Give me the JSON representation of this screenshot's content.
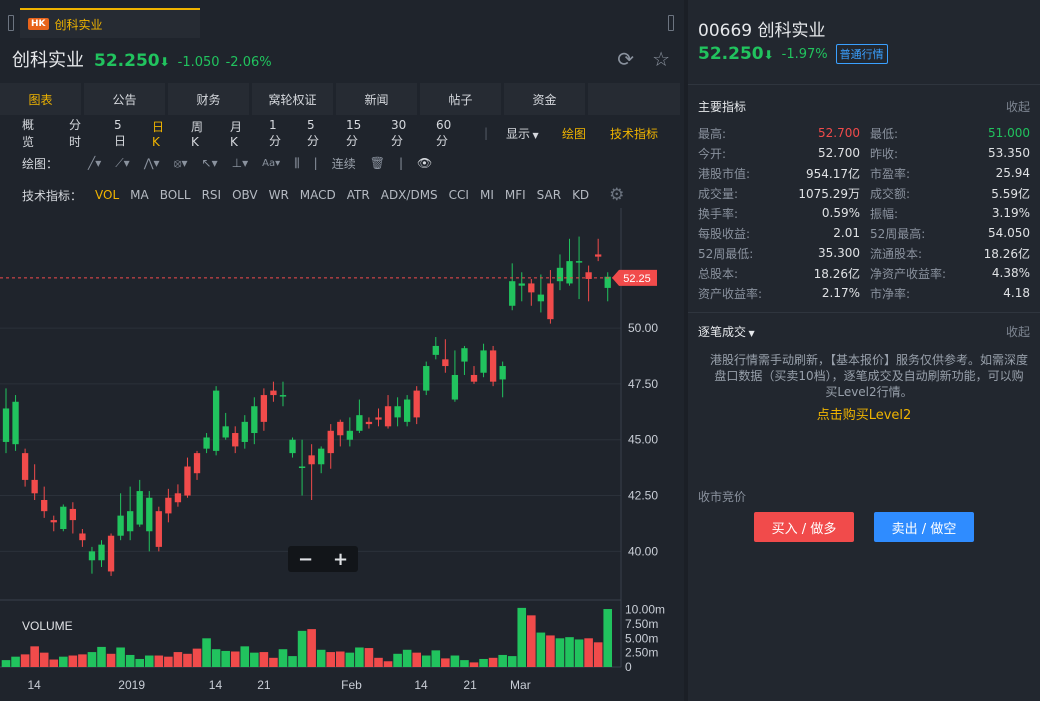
{
  "window_tab": {
    "badge": "HK",
    "label": "创科实业"
  },
  "header": {
    "name": "创科实业",
    "price": "52.250",
    "arrow": "⬇",
    "change": "-1.050",
    "change_pct": "-2.06%"
  },
  "main_tabs": [
    "图表",
    "公告",
    "财务",
    "窝轮权证",
    "新闻",
    "帖子",
    "资金"
  ],
  "periods": [
    "概览",
    "分时",
    "5日",
    "日K",
    "周K",
    "月K",
    "1分",
    "5分",
    "15分",
    "30分",
    "60分"
  ],
  "display_label": "显示",
  "drawing_label": "绘图",
  "tech_label": "技术指标",
  "drawbar": {
    "label": "绘图：",
    "continuous": "连续"
  },
  "indbar": {
    "label": "技术指标：",
    "items": [
      "VOL",
      "MA",
      "BOLL",
      "RSI",
      "OBV",
      "WR",
      "MACD",
      "ATR",
      "ADX/DMS",
      "CCI",
      "MI",
      "MFI",
      "SAR",
      "KD"
    ]
  },
  "chart_data": {
    "type": "candlestick",
    "price_axis": {
      "ticks": [
        "50.00",
        "47.50",
        "45.00",
        "42.50",
        "40.00"
      ],
      "ylim": [
        38.0,
        55.2
      ]
    },
    "current_price_label": "52.25",
    "current_price": 52.25,
    "x_labels": [
      "14",
      "2019",
      "14",
      "21",
      "Feb",
      "14",
      "21",
      "Mar"
    ],
    "volume_label": "VOLUME",
    "volume_axis": {
      "ticks": [
        "10.00m",
        "7.50m",
        "5.00m",
        "2.50m",
        "0"
      ],
      "ymax": 11.5
    },
    "candles": [
      {
        "o": 44.9,
        "c": 46.4,
        "h": 47.3,
        "l": 44.4
      },
      {
        "o": 44.8,
        "c": 46.7,
        "h": 47.0,
        "l": 44.5
      },
      {
        "o": 44.4,
        "c": 43.2,
        "h": 44.6,
        "l": 42.9
      },
      {
        "o": 43.2,
        "c": 42.6,
        "h": 43.9,
        "l": 42.3
      },
      {
        "o": 42.3,
        "c": 41.8,
        "h": 42.9,
        "l": 41.5
      },
      {
        "o": 41.4,
        "c": 41.3,
        "h": 41.6,
        "l": 40.9
      },
      {
        "o": 41.0,
        "c": 42.0,
        "h": 42.1,
        "l": 40.9
      },
      {
        "o": 41.9,
        "c": 41.4,
        "h": 42.2,
        "l": 40.8
      },
      {
        "o": 40.8,
        "c": 40.5,
        "h": 41.0,
        "l": 40.2
      },
      {
        "o": 39.6,
        "c": 40.0,
        "h": 40.2,
        "l": 39.0
      },
      {
        "o": 39.6,
        "c": 40.3,
        "h": 40.5,
        "l": 39.3
      },
      {
        "o": 40.7,
        "c": 39.1,
        "h": 40.8,
        "l": 38.9
      },
      {
        "o": 40.7,
        "c": 41.6,
        "h": 42.6,
        "l": 40.5
      },
      {
        "o": 40.9,
        "c": 41.8,
        "h": 42.9,
        "l": 40.5
      },
      {
        "o": 41.2,
        "c": 42.7,
        "h": 43.2,
        "l": 41.1
      },
      {
        "o": 40.9,
        "c": 42.4,
        "h": 42.7,
        "l": 40.0
      },
      {
        "o": 41.8,
        "c": 40.2,
        "h": 42.0,
        "l": 40.0
      },
      {
        "o": 42.4,
        "c": 41.7,
        "h": 42.8,
        "l": 41.3
      },
      {
        "o": 42.6,
        "c": 42.2,
        "h": 43.0,
        "l": 42.0
      },
      {
        "o": 43.8,
        "c": 42.5,
        "h": 44.2,
        "l": 42.4
      },
      {
        "o": 44.4,
        "c": 43.5,
        "h": 44.5,
        "l": 43.2
      },
      {
        "o": 44.6,
        "c": 45.1,
        "h": 45.3,
        "l": 44.4
      },
      {
        "o": 44.5,
        "c": 47.2,
        "h": 47.4,
        "l": 44.3
      },
      {
        "o": 45.1,
        "c": 45.6,
        "h": 46.2,
        "l": 45.0
      },
      {
        "o": 45.3,
        "c": 44.7,
        "h": 45.6,
        "l": 44.4
      },
      {
        "o": 44.9,
        "c": 45.8,
        "h": 46.1,
        "l": 44.6
      },
      {
        "o": 45.3,
        "c": 46.5,
        "h": 46.9,
        "l": 44.8
      },
      {
        "o": 47.0,
        "c": 45.8,
        "h": 47.3,
        "l": 45.4
      },
      {
        "o": 47.2,
        "c": 47.0,
        "h": 47.6,
        "l": 46.7
      },
      {
        "o": 47.0,
        "c": 47.0,
        "h": 47.6,
        "l": 46.5
      },
      {
        "o": 44.4,
        "c": 45.0,
        "h": 45.1,
        "l": 44.2
      },
      {
        "o": 43.8,
        "c": 43.8,
        "h": 45.0,
        "l": 42.5
      },
      {
        "o": 44.3,
        "c": 43.9,
        "h": 44.8,
        "l": 42.3
      },
      {
        "o": 43.9,
        "c": 44.6,
        "h": 44.7,
        "l": 43.5
      },
      {
        "o": 45.4,
        "c": 44.4,
        "h": 45.7,
        "l": 43.7
      },
      {
        "o": 45.8,
        "c": 45.2,
        "h": 45.9,
        "l": 44.7
      },
      {
        "o": 45.0,
        "c": 45.4,
        "h": 46.0,
        "l": 44.7
      },
      {
        "o": 45.4,
        "c": 46.1,
        "h": 46.8,
        "l": 45.3
      },
      {
        "o": 45.8,
        "c": 45.7,
        "h": 46.0,
        "l": 45.5
      },
      {
        "o": 46.0,
        "c": 45.9,
        "h": 46.4,
        "l": 45.6
      },
      {
        "o": 46.5,
        "c": 45.6,
        "h": 47.0,
        "l": 45.5
      },
      {
        "o": 46.0,
        "c": 46.5,
        "h": 46.9,
        "l": 45.6
      },
      {
        "o": 45.8,
        "c": 46.8,
        "h": 47.0,
        "l": 45.6
      },
      {
        "o": 47.2,
        "c": 46.0,
        "h": 47.4,
        "l": 45.7
      },
      {
        "o": 47.2,
        "c": 48.3,
        "h": 48.5,
        "l": 47.0
      },
      {
        "o": 48.8,
        "c": 49.2,
        "h": 49.6,
        "l": 48.6
      },
      {
        "o": 48.6,
        "c": 48.3,
        "h": 49.5,
        "l": 48.0
      },
      {
        "o": 46.8,
        "c": 47.9,
        "h": 49.0,
        "l": 46.7
      },
      {
        "o": 48.5,
        "c": 49.1,
        "h": 49.2,
        "l": 47.9
      },
      {
        "o": 47.9,
        "c": 47.6,
        "h": 48.3,
        "l": 47.5
      },
      {
        "o": 48.0,
        "c": 49.0,
        "h": 49.3,
        "l": 47.8
      },
      {
        "o": 49.0,
        "c": 47.6,
        "h": 49.2,
        "l": 47.4
      },
      {
        "o": 47.7,
        "c": 48.3,
        "h": 48.5,
        "l": 46.9
      },
      {
        "o": 51.0,
        "c": 52.1,
        "h": 52.9,
        "l": 50.8
      },
      {
        "o": 51.9,
        "c": 52.0,
        "h": 52.5,
        "l": 51.2
      },
      {
        "o": 52.0,
        "c": 51.6,
        "h": 52.2,
        "l": 51.0
      },
      {
        "o": 51.2,
        "c": 51.5,
        "h": 52.4,
        "l": 50.7
      },
      {
        "o": 52.0,
        "c": 50.4,
        "h": 52.6,
        "l": 50.2
      },
      {
        "o": 52.1,
        "c": 52.7,
        "h": 53.3,
        "l": 51.7
      },
      {
        "o": 52.0,
        "c": 53.0,
        "h": 54.0,
        "l": 51.9
      },
      {
        "o": 53.0,
        "c": 53.0,
        "h": 54.1,
        "l": 51.3
      },
      {
        "o": 52.5,
        "c": 52.2,
        "h": 52.8,
        "l": 51.2
      },
      {
        "o": 53.3,
        "c": 53.2,
        "h": 54.0,
        "l": 53.0
      },
      {
        "o": 51.8,
        "c": 52.3,
        "h": 52.5,
        "l": 51.2
      }
    ],
    "volume": [
      1.2,
      1.8,
      2.2,
      3.6,
      2.5,
      1.3,
      1.8,
      2.0,
      2.2,
      2.6,
      3.5,
      2.3,
      3.4,
      2.1,
      1.4,
      2.0,
      2.0,
      1.8,
      2.6,
      2.3,
      3.2,
      5.0,
      3.1,
      2.8,
      2.7,
      3.6,
      2.5,
      2.6,
      1.6,
      3.1,
      1.9,
      6.3,
      6.6,
      3.0,
      2.6,
      2.7,
      2.5,
      3.4,
      3.3,
      1.6,
      1.0,
      2.3,
      3.0,
      2.5,
      2.0,
      2.9,
      1.5,
      2.0,
      1.2,
      0.8,
      1.4,
      1.6,
      2.1,
      1.9,
      10.3,
      9.0,
      6.0,
      5.5,
      5.0,
      5.2,
      4.8,
      5.0,
      4.3,
      10.1
    ],
    "up_color": "#21c35e",
    "down_color": "#f14b4b"
  },
  "zoom": {
    "minus": "−",
    "plus": "+"
  },
  "right": {
    "title": "00669 创科实业",
    "price": "52.250",
    "arrow": "⬇",
    "change_pct": "-1.97%",
    "quote_badge": "普通行情",
    "metrics_title": "主要指标",
    "collapse": "收起",
    "metrics": [
      {
        "l1": "最高:",
        "v1": "52.700",
        "c1": "#f14b4b",
        "l2": "最低:",
        "v2": "51.000",
        "c2": "#21c35e"
      },
      {
        "l1": "今开:",
        "v1": "52.700",
        "c1": "",
        "l2": "昨收:",
        "v2": "53.350",
        "c2": ""
      },
      {
        "l1": "港股市值:",
        "v1": "954.17亿",
        "c1": "",
        "l2": "市盈率:",
        "v2": "25.94",
        "c2": ""
      },
      {
        "l1": "成交量:",
        "v1": "1075.29万",
        "c1": "",
        "l2": "成交额:",
        "v2": "5.59亿",
        "c2": ""
      },
      {
        "l1": "换手率:",
        "v1": "0.59%",
        "c1": "",
        "l2": "振幅:",
        "v2": "3.19%",
        "c2": ""
      },
      {
        "l1": "每股收益:",
        "v1": "2.01",
        "c1": "",
        "l2": "52周最高:",
        "v2": "54.050",
        "c2": ""
      },
      {
        "l1": "52周最低:",
        "v1": "35.300",
        "c1": "",
        "l2": "流通股本:",
        "v2": "18.26亿",
        "c2": ""
      },
      {
        "l1": "总股本:",
        "v1": "18.26亿",
        "c1": "",
        "l2": "净资产收益率:",
        "v2": "4.38%",
        "c2": ""
      },
      {
        "l1": "资产收益率:",
        "v1": "2.17%",
        "c1": "",
        "l2": "市净率:",
        "v2": "4.18",
        "c2": ""
      }
    ],
    "trades_title": "逐笔成交",
    "trades_collapse": "收起",
    "notice": "港股行情需手动刷新，【基本报价】服务仅供参考。如需深度盘口数据（买卖10档），逐笔成交及自动刷新功能，可以购买Level2行情。",
    "level2_link": "点击购买Level2",
    "auction": "收市竞价",
    "buy": "买入 / 做多",
    "sell": "卖出 / 做空"
  }
}
